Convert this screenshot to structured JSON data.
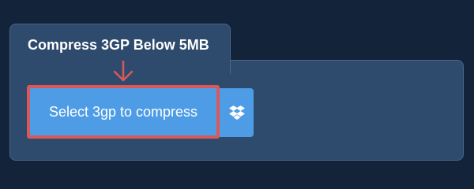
{
  "tab": {
    "title": "Compress 3GP Below 5MB"
  },
  "upload": {
    "select_label": "Select 3gp to compress",
    "dropbox_icon": "dropbox-icon"
  },
  "annotation": {
    "arrow_icon": "arrow-down-icon",
    "highlight_color": "#d9595a"
  },
  "colors": {
    "background": "#13233a",
    "panel": "#2e4a6c",
    "button": "#4e9ce6",
    "highlight": "#d9595a"
  }
}
